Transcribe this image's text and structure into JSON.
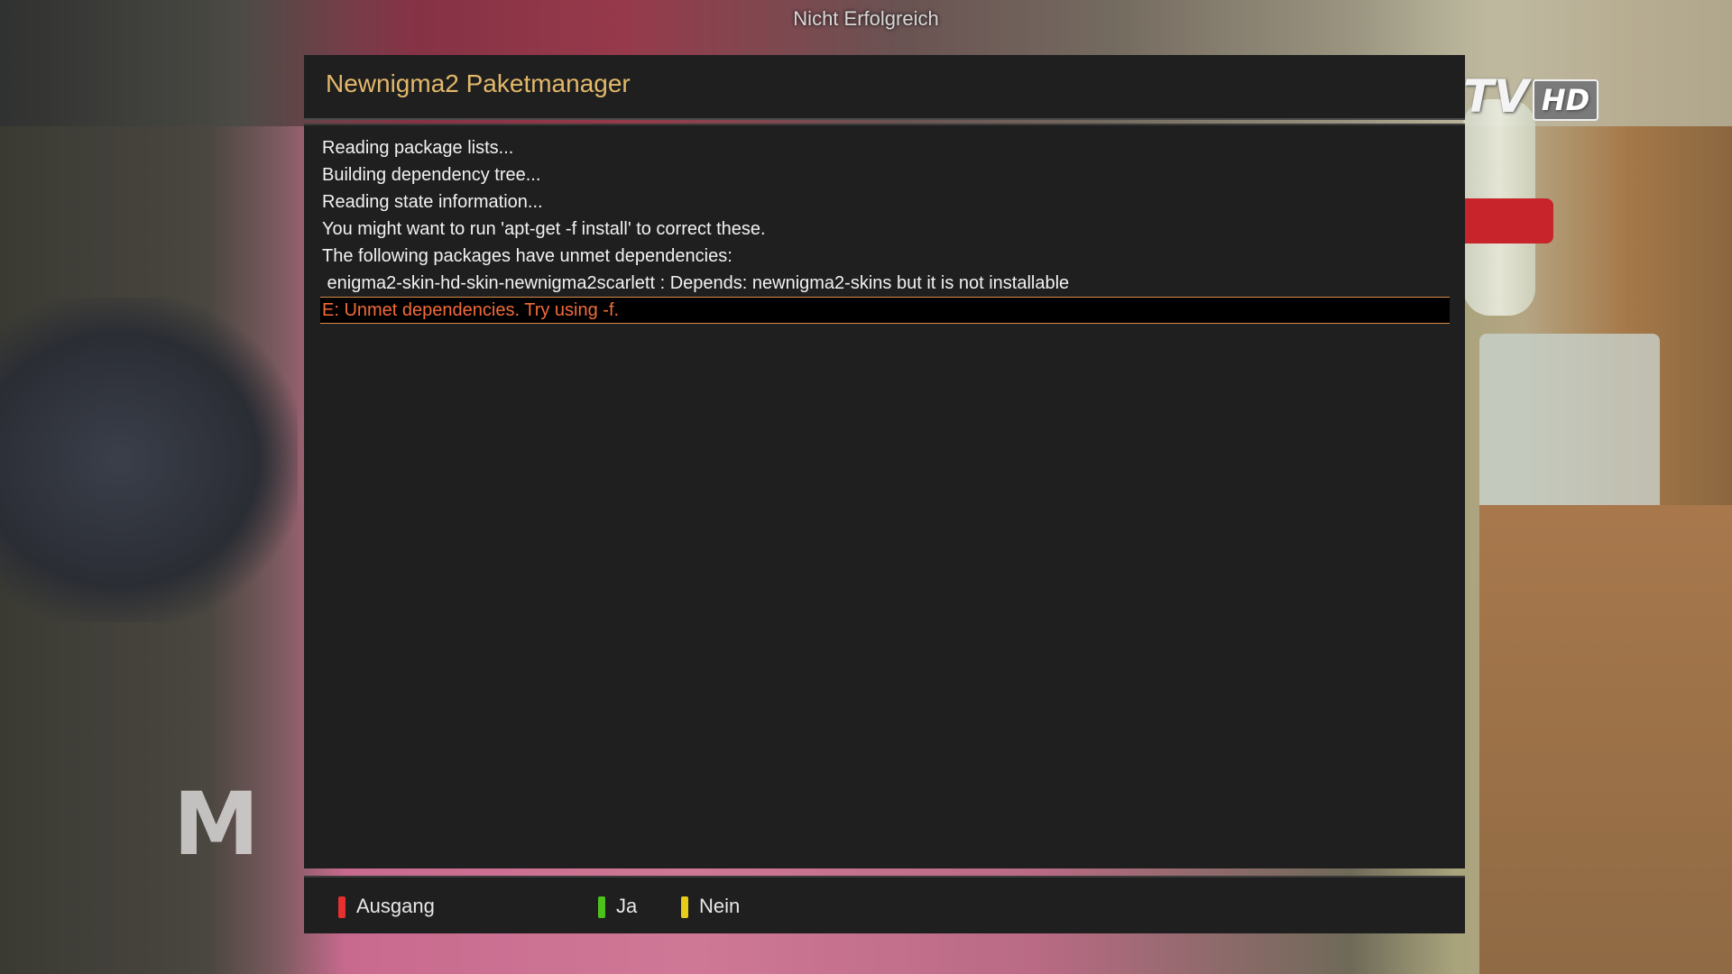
{
  "status": "Nicht Erfolgreich",
  "window": {
    "title": "Newnigma2 Paketmanager"
  },
  "log": [
    {
      "text": "Reading package lists...",
      "selected": false
    },
    {
      "text": "Building dependency tree...",
      "selected": false
    },
    {
      "text": "Reading state information...",
      "selected": false
    },
    {
      "text": "You might want to run 'apt-get -f install' to correct these.",
      "selected": false
    },
    {
      "text": "The following packages have unmet dependencies:",
      "selected": false
    },
    {
      "text": " enigma2-skin-hd-skin-newnigma2scarlett : Depends: newnigma2-skins but it is not installable",
      "selected": false
    },
    {
      "text": "E: Unmet dependencies. Try using -f.",
      "selected": true
    }
  ],
  "footer": {
    "red": {
      "label": "Ausgang",
      "color": "#e53030"
    },
    "green": {
      "label": "Ja",
      "color": "#4cc21c"
    },
    "yellow": {
      "label": "Nein",
      "color": "#e8cc1c"
    }
  },
  "colors": {
    "title": "#e3b86a",
    "selected_text": "#f26b3a",
    "panel_bg": "#1f1f1f"
  }
}
